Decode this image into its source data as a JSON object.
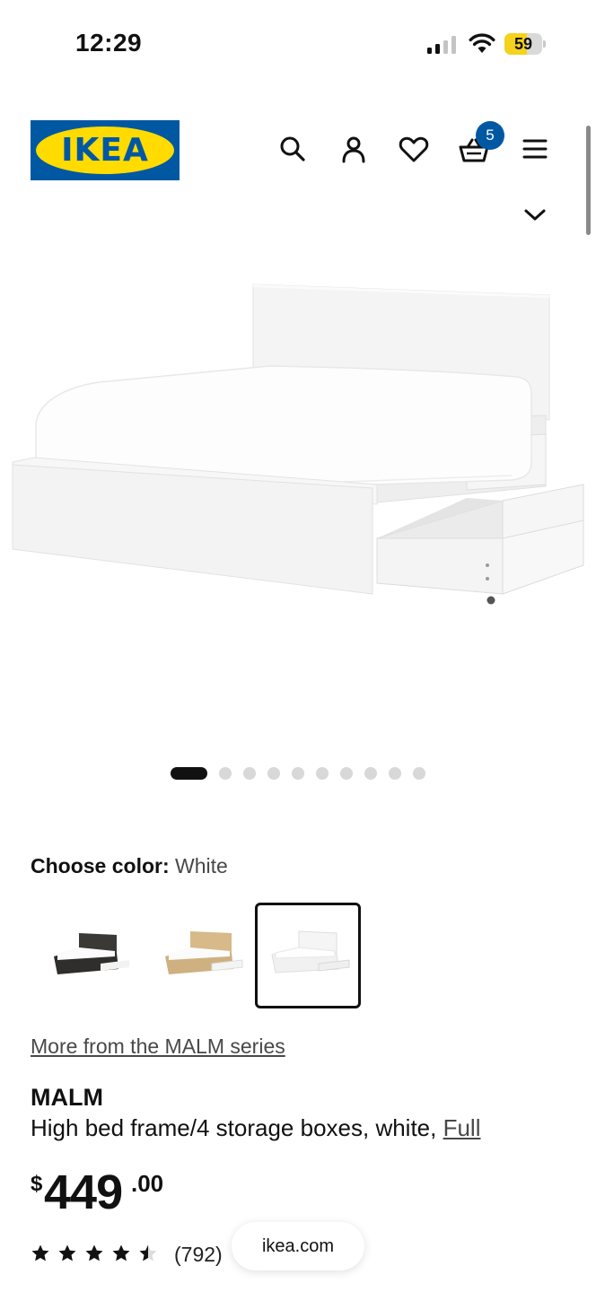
{
  "status_bar": {
    "time": "12:29",
    "battery_level": "59",
    "battery_fraction": 0.59,
    "battery_color": "#f5d21d"
  },
  "header": {
    "logo_text": "IKEA",
    "logo_colors": {
      "blue": "#0058a3",
      "yellow": "#ffdb00"
    },
    "icons": [
      "search-icon",
      "account-icon",
      "heart-icon",
      "basket-icon",
      "menu-icon"
    ],
    "cart_count": "5"
  },
  "carousel": {
    "total_images": 10,
    "active_index": 0
  },
  "product": {
    "color_label": "Choose color:",
    "color_value": "White",
    "swatches": [
      {
        "name": "black-brown",
        "selected": false
      },
      {
        "name": "oak veneer",
        "selected": false
      },
      {
        "name": "white",
        "selected": true
      }
    ],
    "series_link": "More from the MALM series",
    "name": "MALM",
    "description": "High bed frame/4 storage boxes, white, ",
    "size_link": "Full",
    "price_currency": "$",
    "price_integer": "449",
    "price_decimal": ".00",
    "rating_stars": 4.5,
    "rating_count": "(792)"
  },
  "browser": {
    "url": "ikea.com"
  }
}
